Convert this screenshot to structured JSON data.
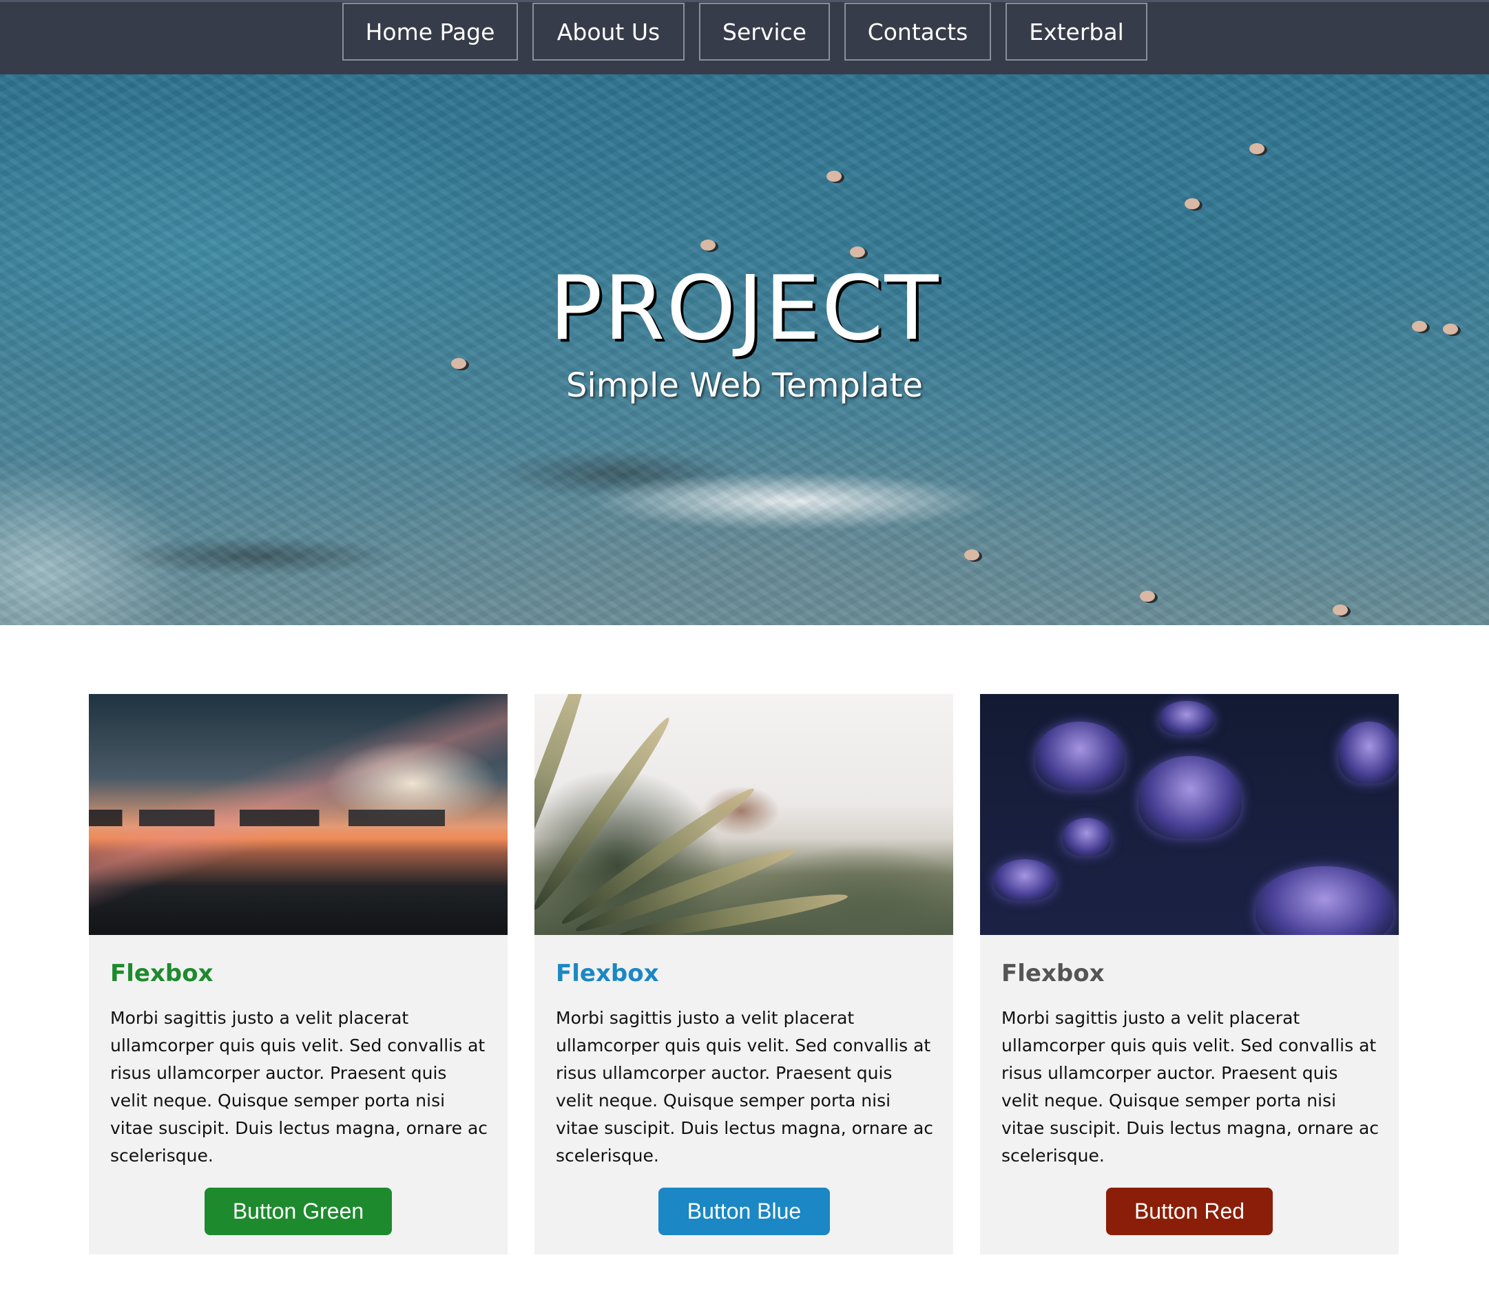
{
  "nav": {
    "items": [
      {
        "label": "Home Page"
      },
      {
        "label": "About Us"
      },
      {
        "label": "Service"
      },
      {
        "label": "Contacts"
      },
      {
        "label": "Exterbal"
      }
    ]
  },
  "hero": {
    "title": "PROJECT",
    "subtitle": "Simple Web Template"
  },
  "cards": [
    {
      "title": "Flexbox",
      "text": "Morbi sagittis justo a velit placerat ullamcorper quis quis velit. Sed convallis at risus ullamcorper auctor. Praesent quis velit neque. Quisque semper porta nisi vitae suscipit. Duis lectus magna, ornare ac scelerisque.",
      "button_label": "Button Green",
      "accent": "#1e8a2e"
    },
    {
      "title": "Flexbox",
      "text": "Morbi sagittis justo a velit placerat ullamcorper quis quis velit. Sed convallis at risus ullamcorper auctor. Praesent quis velit neque. Quisque semper porta nisi vitae suscipit. Duis lectus magna, ornare ac scelerisque.",
      "button_label": "Button Blue",
      "accent": "#1b87c5"
    },
    {
      "title": "Flexbox",
      "text": "Morbi sagittis justo a velit placerat ullamcorper quis quis velit. Sed convallis at risus ullamcorper auctor. Praesent quis velit neque. Quisque semper porta nisi vitae suscipit. Duis lectus magna, ornare ac scelerisque.",
      "button_label": "Button Red",
      "accent": "#8b1e08",
      "title_color": "#555555"
    }
  ],
  "colors": {
    "nav_bg": "#373c4a",
    "card_bg": "#f2f2f2"
  }
}
